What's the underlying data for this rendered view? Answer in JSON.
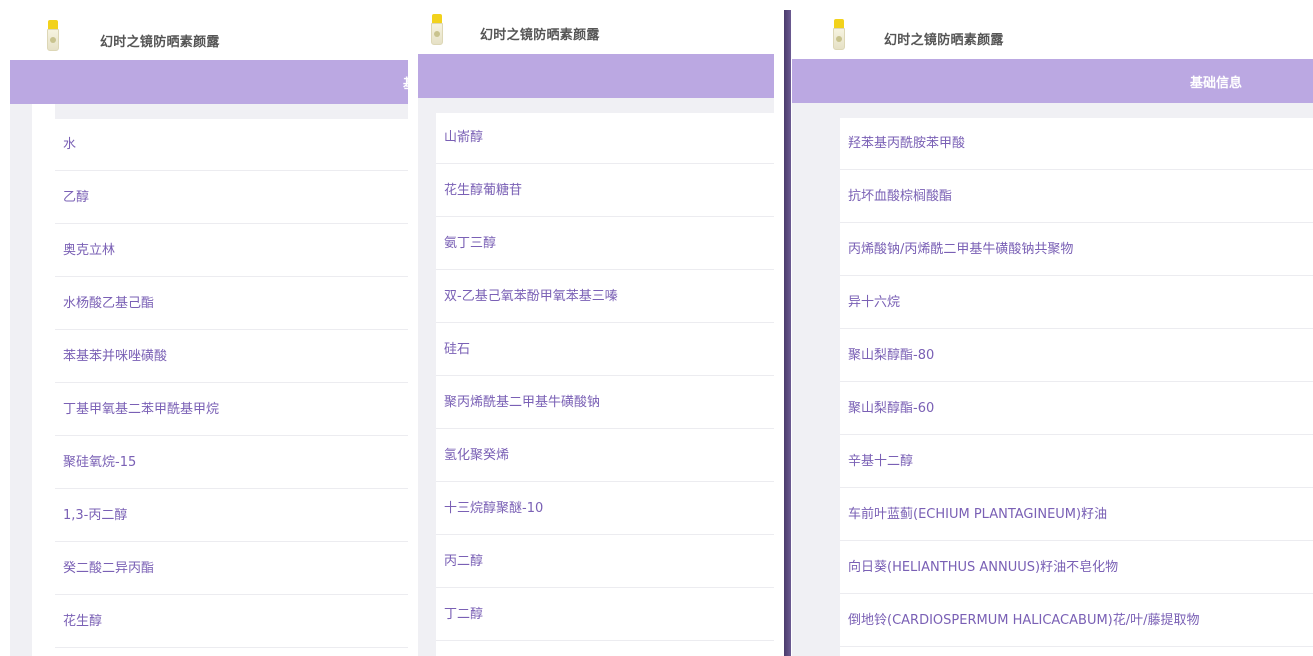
{
  "product": {
    "title": "幻时之镜防晒素颜露",
    "thumbnail_icon": "sunscreen-bottle-icon"
  },
  "tab_bar": {
    "label": "基础信息",
    "color": "#bba8e2"
  },
  "colors": {
    "ingredient_text": "#7a60b5",
    "divider_bar": "#4a3b6b"
  },
  "panels": [
    {
      "ingredients": [
        "水",
        "乙醇",
        "奥克立林",
        "水杨酸乙基己酯",
        "苯基苯并咪唑磺酸",
        "丁基甲氧基二苯甲酰基甲烷",
        "聚硅氧烷-15",
        "1,3-丙二醇",
        "癸二酸二异丙酯",
        "花生醇"
      ]
    },
    {
      "ingredients": [
        "山嵛醇",
        "花生醇葡糖苷",
        "氨丁三醇",
        "双-乙基己氧苯酚甲氧苯基三嗪",
        "硅石",
        "聚丙烯酰基二甲基牛磺酸钠",
        "氢化聚癸烯",
        "十三烷醇聚醚-10",
        "丙二醇",
        "丁二醇"
      ]
    },
    {
      "ingredients": [
        "羟苯基丙酰胺苯甲酸",
        "抗坏血酸棕榈酸酯",
        "丙烯酸钠/丙烯酰二甲基牛磺酸钠共聚物",
        "异十六烷",
        "聚山梨醇酯-80",
        "聚山梨醇酯-60",
        "辛基十二醇",
        "车前叶蓝蓟(ECHIUM PLANTAGINEUM)籽油",
        "向日葵(HELIANTHUS ANNUUS)籽油不皂化物",
        "倒地铃(CARDIOSPERMUM HALICACABUM)花/叶/藤提取物"
      ]
    }
  ]
}
